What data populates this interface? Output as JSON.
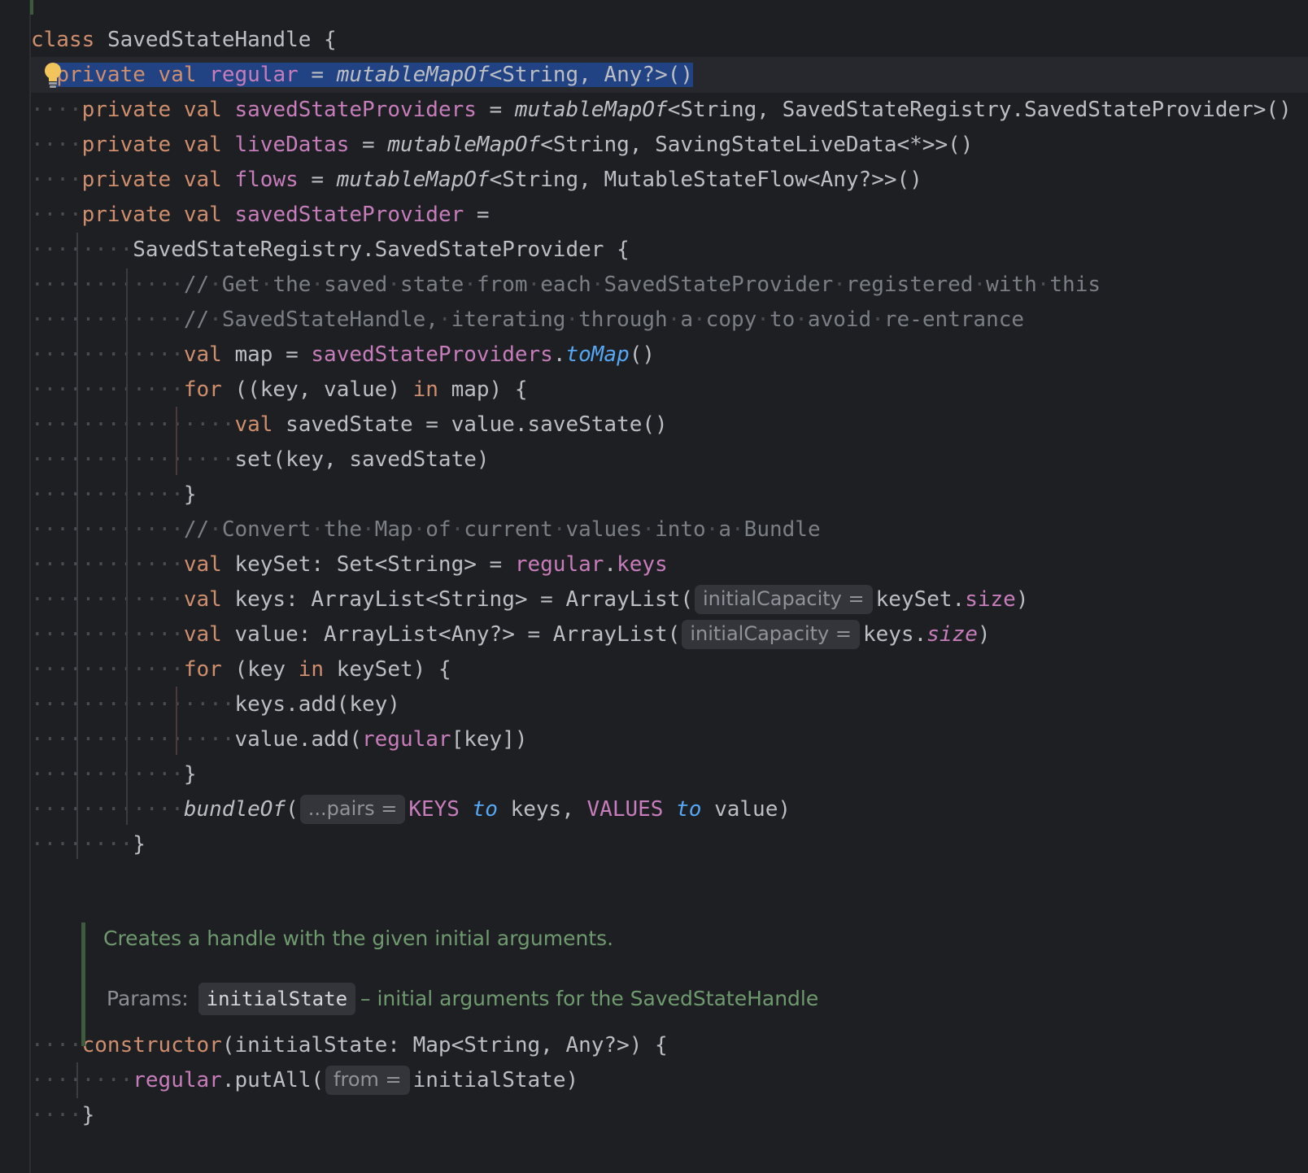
{
  "editor": {
    "language": "Kotlin",
    "lines": [
      [
        {
          "t": "class",
          "c": "kw"
        },
        {
          "t": " ",
          "c": "ws"
        },
        {
          "t": "SavedStateHandle"
        },
        {
          "t": " ",
          "c": "ws"
        },
        {
          "t": "{"
        }
      ],
      [
        {
          "t": "private",
          "c": "kw"
        },
        {
          "t": " ",
          "c": "ws"
        },
        {
          "t": "val",
          "c": "kw"
        },
        {
          "t": " ",
          "c": "ws"
        },
        {
          "t": "regular",
          "c": "prop"
        },
        {
          "t": " = "
        },
        {
          "t": "mutableMapOf",
          "c": "ital"
        },
        {
          "t": "<String,"
        },
        {
          "t": " ",
          "c": "ws"
        },
        {
          "t": "Any?>()"
        }
      ],
      [
        {
          "t": "····",
          "c": "ws"
        },
        {
          "t": "private",
          "c": "kw"
        },
        {
          "t": " ",
          "c": "ws"
        },
        {
          "t": "val",
          "c": "kw"
        },
        {
          "t": " ",
          "c": "ws"
        },
        {
          "t": "savedStateProviders",
          "c": "prop"
        },
        {
          "t": " = "
        },
        {
          "t": "mutableMapOf",
          "c": "ital"
        },
        {
          "t": "<String,"
        },
        {
          "t": " ",
          "c": "ws"
        },
        {
          "t": "SavedStateRegistry.SavedStateProvider>()"
        }
      ],
      [
        {
          "t": "····",
          "c": "ws"
        },
        {
          "t": "private",
          "c": "kw"
        },
        {
          "t": " ",
          "c": "ws"
        },
        {
          "t": "val",
          "c": "kw"
        },
        {
          "t": " ",
          "c": "ws"
        },
        {
          "t": "liveDatas",
          "c": "prop"
        },
        {
          "t": " = "
        },
        {
          "t": "mutableMapOf",
          "c": "ital"
        },
        {
          "t": "<String,"
        },
        {
          "t": " ",
          "c": "ws"
        },
        {
          "t": "SavingStateLiveData<*>>()"
        }
      ],
      [
        {
          "t": "····",
          "c": "ws"
        },
        {
          "t": "private",
          "c": "kw"
        },
        {
          "t": " ",
          "c": "ws"
        },
        {
          "t": "val",
          "c": "kw"
        },
        {
          "t": " ",
          "c": "ws"
        },
        {
          "t": "flows",
          "c": "prop"
        },
        {
          "t": " = "
        },
        {
          "t": "mutableMapOf",
          "c": "ital"
        },
        {
          "t": "<String,"
        },
        {
          "t": " ",
          "c": "ws"
        },
        {
          "t": "MutableStateFlow<Any?>>()"
        }
      ],
      [
        {
          "t": "····",
          "c": "ws"
        },
        {
          "t": "private",
          "c": "kw"
        },
        {
          "t": " ",
          "c": "ws"
        },
        {
          "t": "val",
          "c": "kw"
        },
        {
          "t": " ",
          "c": "ws"
        },
        {
          "t": "savedStateProvider",
          "c": "prop"
        },
        {
          "t": " ="
        }
      ],
      [
        {
          "t": "········",
          "c": "ws"
        },
        {
          "t": "SavedStateRegistry.SavedStateProvider"
        },
        {
          "t": " ",
          "c": "ws"
        },
        {
          "t": "{"
        }
      ],
      [
        {
          "t": "············",
          "c": "ws"
        },
        {
          "t": "//",
          "c": "cm"
        },
        {
          "t": "·",
          "c": "ws"
        },
        {
          "t": "Get",
          "c": "cm"
        },
        {
          "t": "·",
          "c": "ws"
        },
        {
          "t": "the",
          "c": "cm"
        },
        {
          "t": "·",
          "c": "ws"
        },
        {
          "t": "saved",
          "c": "cm"
        },
        {
          "t": "·",
          "c": "ws"
        },
        {
          "t": "state",
          "c": "cm"
        },
        {
          "t": "·",
          "c": "ws"
        },
        {
          "t": "from",
          "c": "cm"
        },
        {
          "t": "·",
          "c": "ws"
        },
        {
          "t": "each",
          "c": "cm"
        },
        {
          "t": "·",
          "c": "ws"
        },
        {
          "t": "SavedStateProvider",
          "c": "cm"
        },
        {
          "t": "·",
          "c": "ws"
        },
        {
          "t": "registered",
          "c": "cm"
        },
        {
          "t": "·",
          "c": "ws"
        },
        {
          "t": "with",
          "c": "cm"
        },
        {
          "t": "·",
          "c": "ws"
        },
        {
          "t": "this",
          "c": "cm"
        }
      ],
      [
        {
          "t": "············",
          "c": "ws"
        },
        {
          "t": "//",
          "c": "cm"
        },
        {
          "t": "·",
          "c": "ws"
        },
        {
          "t": "SavedStateHandle,",
          "c": "cm"
        },
        {
          "t": "·",
          "c": "ws"
        },
        {
          "t": "iterating",
          "c": "cm"
        },
        {
          "t": "·",
          "c": "ws"
        },
        {
          "t": "through",
          "c": "cm"
        },
        {
          "t": "·",
          "c": "ws"
        },
        {
          "t": "a",
          "c": "cm"
        },
        {
          "t": "·",
          "c": "ws"
        },
        {
          "t": "copy",
          "c": "cm"
        },
        {
          "t": "·",
          "c": "ws"
        },
        {
          "t": "to",
          "c": "cm"
        },
        {
          "t": "·",
          "c": "ws"
        },
        {
          "t": "avoid",
          "c": "cm"
        },
        {
          "t": "·",
          "c": "ws"
        },
        {
          "t": "re-entrance",
          "c": "cm"
        }
      ],
      [
        {
          "t": "············",
          "c": "ws"
        },
        {
          "t": "val",
          "c": "kw"
        },
        {
          "t": " ",
          "c": "ws"
        },
        {
          "t": "map = "
        },
        {
          "t": "savedStateProviders",
          "c": "prop"
        },
        {
          "t": "."
        },
        {
          "t": "toMap",
          "c": "fn ital"
        },
        {
          "t": "()"
        }
      ],
      [
        {
          "t": "············",
          "c": "ws"
        },
        {
          "t": "for",
          "c": "kw"
        },
        {
          "t": " ",
          "c": "ws"
        },
        {
          "t": "((key,"
        },
        {
          "t": " ",
          "c": "ws"
        },
        {
          "t": "value)"
        },
        {
          "t": " ",
          "c": "ws"
        },
        {
          "t": "in",
          "c": "kw"
        },
        {
          "t": " ",
          "c": "ws"
        },
        {
          "t": "map)"
        },
        {
          "t": " ",
          "c": "ws"
        },
        {
          "t": "{"
        }
      ],
      [
        {
          "t": "················",
          "c": "ws"
        },
        {
          "t": "val",
          "c": "kw"
        },
        {
          "t": " ",
          "c": "ws"
        },
        {
          "t": "savedState = value.saveState()"
        }
      ],
      [
        {
          "t": "················",
          "c": "ws"
        },
        {
          "t": "set(key,"
        },
        {
          "t": " ",
          "c": "ws"
        },
        {
          "t": "savedState)"
        }
      ],
      [
        {
          "t": "············",
          "c": "ws"
        },
        {
          "t": "}"
        }
      ],
      [
        {
          "t": "············",
          "c": "ws"
        },
        {
          "t": "//",
          "c": "cm"
        },
        {
          "t": "·",
          "c": "ws"
        },
        {
          "t": "Convert",
          "c": "cm"
        },
        {
          "t": "·",
          "c": "ws"
        },
        {
          "t": "the",
          "c": "cm"
        },
        {
          "t": "·",
          "c": "ws"
        },
        {
          "t": "Map",
          "c": "cm"
        },
        {
          "t": "·",
          "c": "ws"
        },
        {
          "t": "of",
          "c": "cm"
        },
        {
          "t": "·",
          "c": "ws"
        },
        {
          "t": "current",
          "c": "cm"
        },
        {
          "t": "·",
          "c": "ws"
        },
        {
          "t": "values",
          "c": "cm"
        },
        {
          "t": "·",
          "c": "ws"
        },
        {
          "t": "into",
          "c": "cm"
        },
        {
          "t": "·",
          "c": "ws"
        },
        {
          "t": "a",
          "c": "cm"
        },
        {
          "t": "·",
          "c": "ws"
        },
        {
          "t": "Bundle",
          "c": "cm"
        }
      ],
      [
        {
          "t": "············",
          "c": "ws"
        },
        {
          "t": "val",
          "c": "kw"
        },
        {
          "t": " ",
          "c": "ws"
        },
        {
          "t": "keySet: Set<String> = "
        },
        {
          "t": "regular",
          "c": "prop"
        },
        {
          "t": "."
        },
        {
          "t": "keys",
          "c": "prop"
        }
      ],
      [
        {
          "t": "············",
          "c": "ws"
        },
        {
          "t": "val",
          "c": "kw"
        },
        {
          "t": " ",
          "c": "ws"
        },
        {
          "t": "keys: ArrayList<String> = ArrayList("
        },
        {
          "t": "initialCapacity =",
          "c": "hint"
        },
        {
          "t": "keySet."
        },
        {
          "t": "size",
          "c": "prop"
        },
        {
          "t": ")"
        }
      ],
      [
        {
          "t": "············",
          "c": "ws"
        },
        {
          "t": "val",
          "c": "kw"
        },
        {
          "t": " ",
          "c": "ws"
        },
        {
          "t": "value: ArrayList<Any?> = ArrayList("
        },
        {
          "t": "initialCapacity =",
          "c": "hint"
        },
        {
          "t": "keys."
        },
        {
          "t": "size",
          "c": "prop ital"
        },
        {
          "t": ")"
        }
      ],
      [
        {
          "t": "············",
          "c": "ws"
        },
        {
          "t": "for",
          "c": "kw"
        },
        {
          "t": " ",
          "c": "ws"
        },
        {
          "t": "(key"
        },
        {
          "t": " ",
          "c": "ws"
        },
        {
          "t": "in",
          "c": "kw"
        },
        {
          "t": " ",
          "c": "ws"
        },
        {
          "t": "keySet)"
        },
        {
          "t": " ",
          "c": "ws"
        },
        {
          "t": "{"
        }
      ],
      [
        {
          "t": "················",
          "c": "ws"
        },
        {
          "t": "keys.add(key)"
        }
      ],
      [
        {
          "t": "················",
          "c": "ws"
        },
        {
          "t": "value.add("
        },
        {
          "t": "regular",
          "c": "prop"
        },
        {
          "t": "[key])"
        }
      ],
      [
        {
          "t": "············",
          "c": "ws"
        },
        {
          "t": "}"
        }
      ],
      [
        {
          "t": "············",
          "c": "ws"
        },
        {
          "t": "bundleOf",
          "c": "ital"
        },
        {
          "t": "("
        },
        {
          "t": "...pairs =",
          "c": "hint"
        },
        {
          "t": "KEYS",
          "c": "prop"
        },
        {
          "t": " ",
          "c": "ws"
        },
        {
          "t": "to",
          "c": "fn ital"
        },
        {
          "t": " ",
          "c": "ws"
        },
        {
          "t": "keys,"
        },
        {
          "t": " ",
          "c": "ws"
        },
        {
          "t": "VALUES",
          "c": "prop"
        },
        {
          "t": " ",
          "c": "ws"
        },
        {
          "t": "to",
          "c": "fn ital"
        },
        {
          "t": " ",
          "c": "ws"
        },
        {
          "t": "value)"
        }
      ],
      [
        {
          "t": "········",
          "c": "ws"
        },
        {
          "t": "}"
        }
      ]
    ],
    "doc_comment": {
      "summary": "Creates a handle with the given initial arguments.",
      "params_label": "Params:",
      "param_name": "initialState",
      "param_desc": "– initial arguments for the SavedStateHandle"
    },
    "lines_after": [
      [
        {
          "t": "····",
          "c": "ws"
        },
        {
          "t": "constructor",
          "c": "kw"
        },
        {
          "t": "(initialState:"
        },
        {
          "t": " ",
          "c": "ws"
        },
        {
          "t": "Map<String,"
        },
        {
          "t": " ",
          "c": "ws"
        },
        {
          "t": "Any?>)"
        },
        {
          "t": " ",
          "c": "ws"
        },
        {
          "t": "{"
        }
      ],
      [
        {
          "t": "········",
          "c": "ws"
        },
        {
          "t": "regular",
          "c": "prop"
        },
        {
          "t": ".putAll("
        },
        {
          "t": "from =",
          "c": "hint"
        },
        {
          "t": "initialState)"
        }
      ],
      [
        {
          "t": "····",
          "c": "ws"
        },
        {
          "t": "}"
        }
      ]
    ],
    "colors": {
      "background": "#1e1f22",
      "keyword": "#cf8e6d",
      "property": "#c77dbb",
      "function": "#56a8f5",
      "comment": "#7a7e85",
      "doc_comment": "#6f9a6f",
      "selection": "#214283"
    },
    "icons": {
      "intention": "lightbulb-icon"
    }
  }
}
